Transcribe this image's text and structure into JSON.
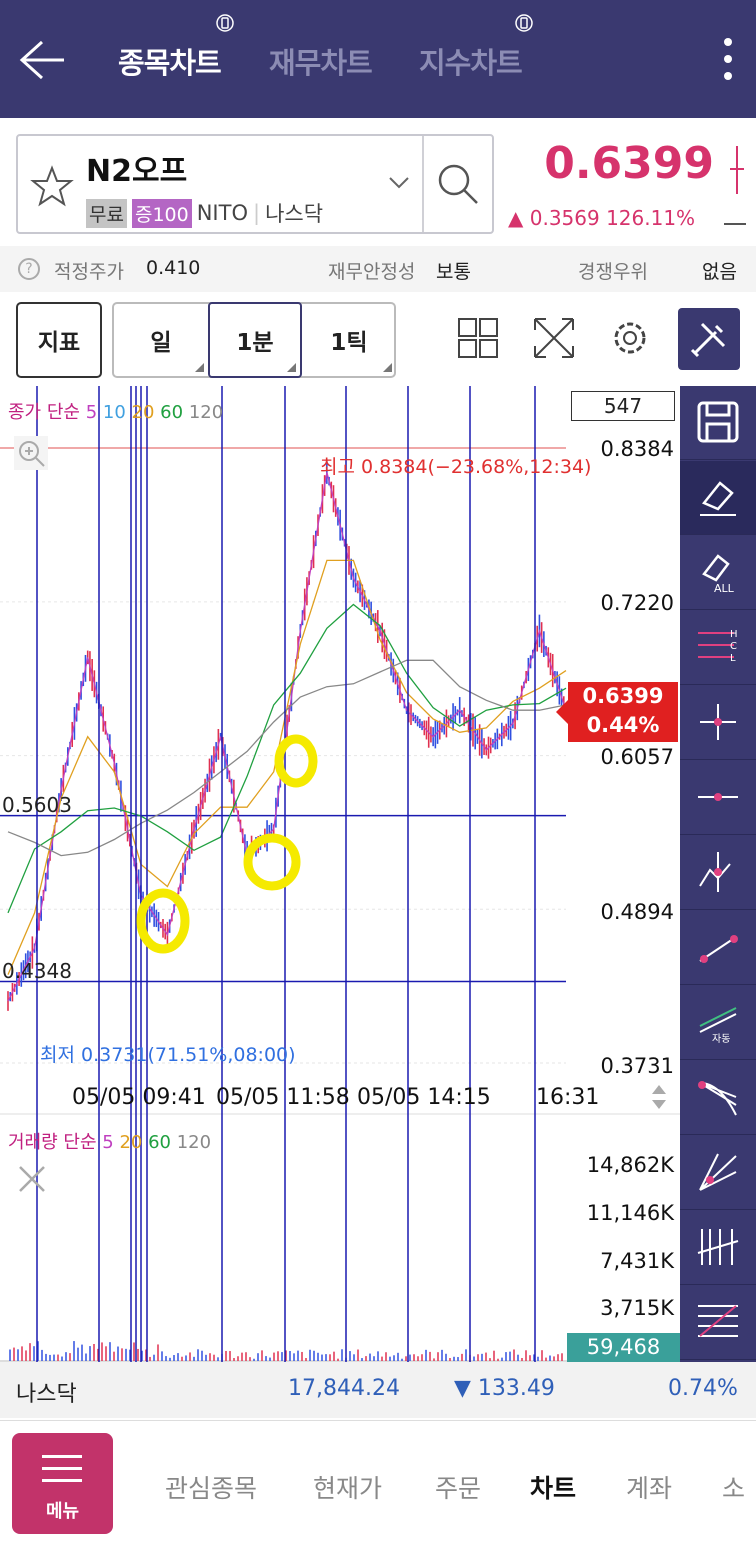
{
  "header": {
    "tabs": [
      {
        "label": "종목차트",
        "active": true
      },
      {
        "label": "재무차트",
        "active": false
      },
      {
        "label": "지수차트",
        "active": false
      }
    ]
  },
  "stock": {
    "name": "N2오프",
    "tags": [
      "무료",
      "증100",
      "NITO",
      "나스닥"
    ],
    "price": "0.6399",
    "change": "▲ 0.3569  126.11%"
  },
  "info": {
    "fair_price_label": "적정주가",
    "fair_price_value": "0.410",
    "stability_label": "재무안정성",
    "stability_value": "보통",
    "competition_label": "경쟁우위",
    "competition_value": "없음"
  },
  "toolbar": {
    "indicator_label": "지표",
    "period_day": "일",
    "period_min": "1분",
    "period_tick": "1틱"
  },
  "chart": {
    "legend_price": [
      "종가 단순",
      "5",
      "10",
      "20",
      "60",
      "120"
    ],
    "legend_volume": [
      "거래량 단순",
      "5",
      "20",
      "60",
      "120"
    ],
    "count_box": "547",
    "y_ticks": [
      "0.8384",
      "0.7220",
      "0.6057",
      "0.4894",
      "0.3731"
    ],
    "left_labels": [
      "0.5603",
      "0.4348"
    ],
    "max_label": "최고 0.8384(−23.68%,12:34)",
    "min_label": "최저 0.3731(71.51%,08:00)",
    "current_price": "0.6399",
    "current_pct": "0.44%",
    "x_labels": [
      "05/05 09:41",
      "05/05 11:58",
      "05/05 14:15",
      "16:31"
    ],
    "vol_ticks": [
      "14,862K",
      "11,146K",
      "7,431K",
      "3,715K"
    ],
    "volume_current": "59,468"
  },
  "chart_data": {
    "type": "candlestick",
    "title": "",
    "ylim": [
      0.3731,
      0.8384
    ],
    "y_ticks": [
      0.8384,
      0.722,
      0.6057,
      0.4894,
      0.3731
    ],
    "x_labels": [
      "05/05 09:41",
      "05/05 11:58",
      "05/05 14:15",
      "16:31"
    ],
    "high": 0.8384,
    "low": 0.3731,
    "last": 0.6399,
    "horizontal_lines": [
      0.5603,
      0.4348
    ],
    "approx_close_path": [
      0.42,
      0.46,
      0.58,
      0.68,
      0.6,
      0.5,
      0.47,
      0.55,
      0.62,
      0.53,
      0.55,
      0.7,
      0.82,
      0.74,
      0.7,
      0.64,
      0.62,
      0.64,
      0.61,
      0.63,
      0.7,
      0.64
    ],
    "volume_ticks": [
      14862,
      11146,
      7431,
      3715
    ],
    "volume_current": 59468
  },
  "index_bar": {
    "name": "나스닥",
    "value": "17,844.24",
    "change": "▼ 133.49",
    "pct": "0.74%"
  },
  "bottom_nav": {
    "menu_label": "메뉴",
    "items": [
      {
        "label": "관심종목",
        "active": false
      },
      {
        "label": "현재가",
        "active": false
      },
      {
        "label": "주문",
        "active": false
      },
      {
        "label": "차트",
        "active": true
      },
      {
        "label": "계좌",
        "active": false
      },
      {
        "label": "소",
        "active": false
      }
    ]
  }
}
